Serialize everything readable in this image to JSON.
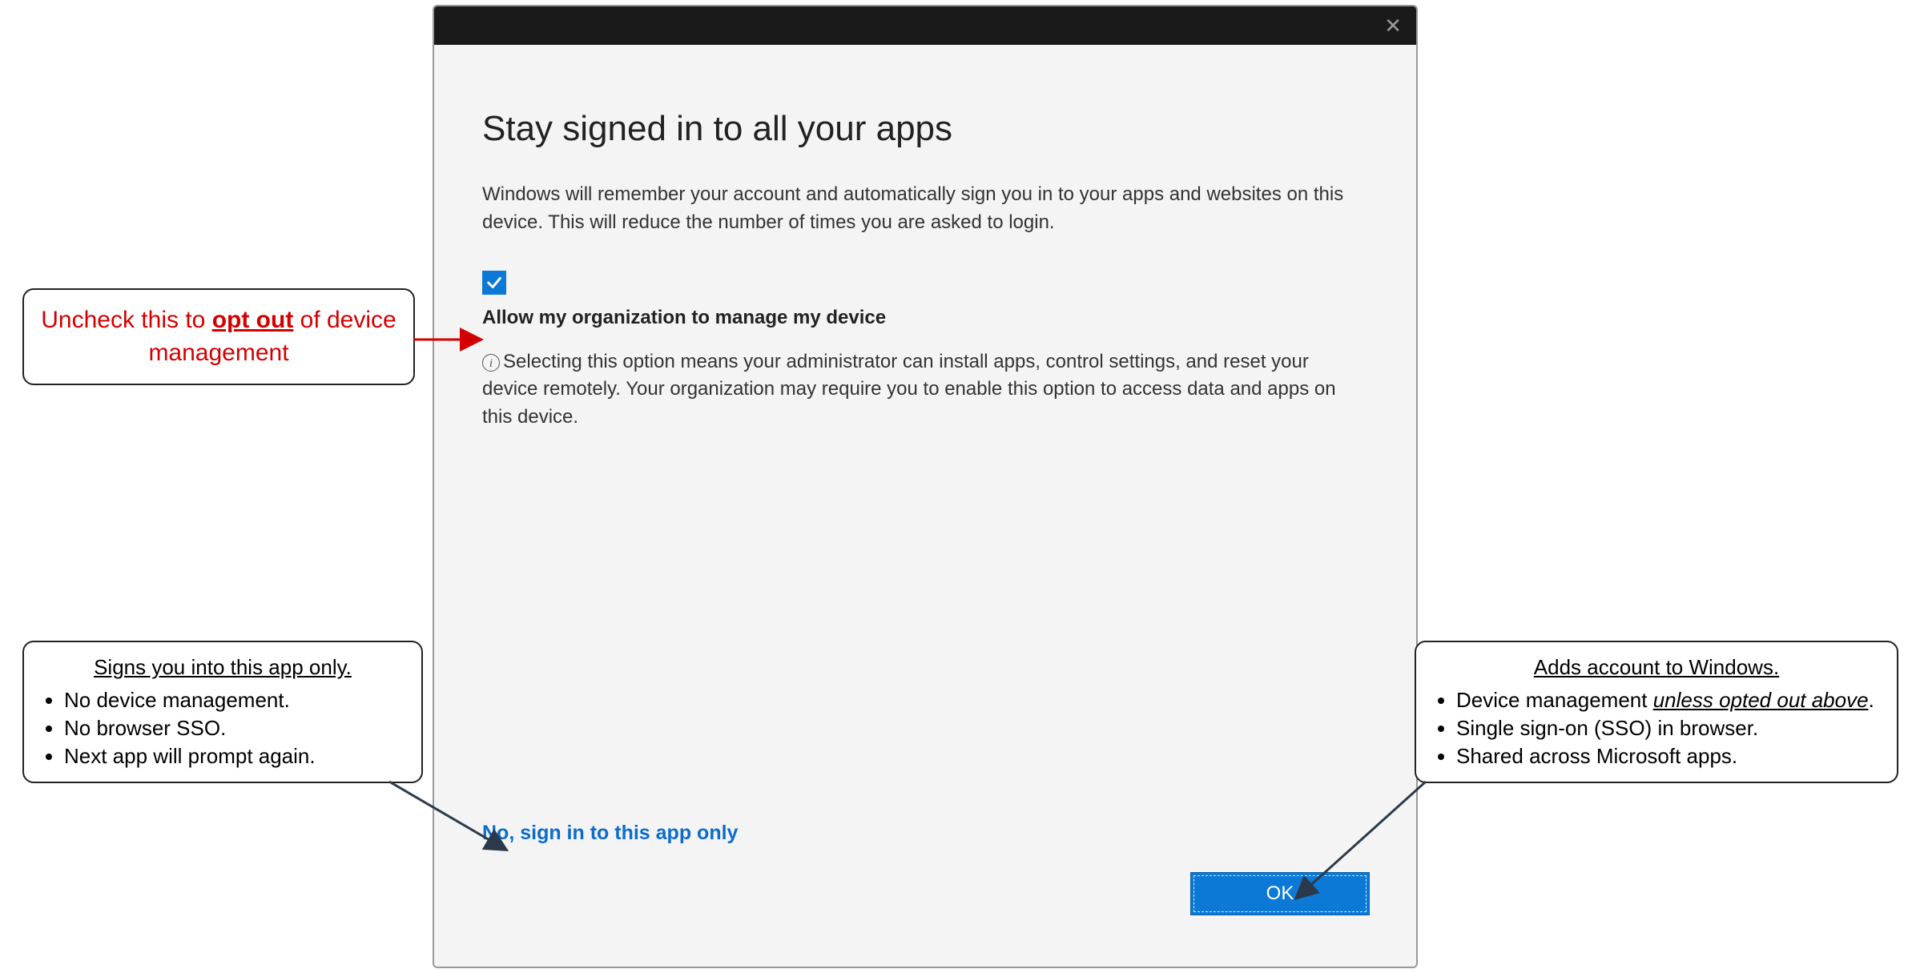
{
  "dialog": {
    "title": "Stay signed in to all your apps",
    "body": "Windows will remember your account and automatically sign you in to your apps and websites on this device. This will reduce the number of times you are asked to login.",
    "checkbox_label": "Allow my organization to manage my device",
    "info_text": "Selecting this option means your administrator can install apps, control settings, and reset your device remotely. Your organization may require you to enable this option to access data and apps on this device.",
    "link_only": "No, sign in to this app only",
    "ok": "OK"
  },
  "callout_red": {
    "pre": "Uncheck this to ",
    "bold": "opt out",
    "post": " of device management"
  },
  "callout_left": {
    "heading": "Signs you into this app only.",
    "b1": "No device management.",
    "b2": "No browser SSO.",
    "b3": "Next app will prompt again."
  },
  "callout_right": {
    "heading": "Adds account to Windows.",
    "b1a": "Device management ",
    "b1b": "unless opted out above",
    "b1c": ".",
    "b2": "Single sign-on (SSO) in browser.",
    "b3": "Shared across Microsoft apps."
  }
}
